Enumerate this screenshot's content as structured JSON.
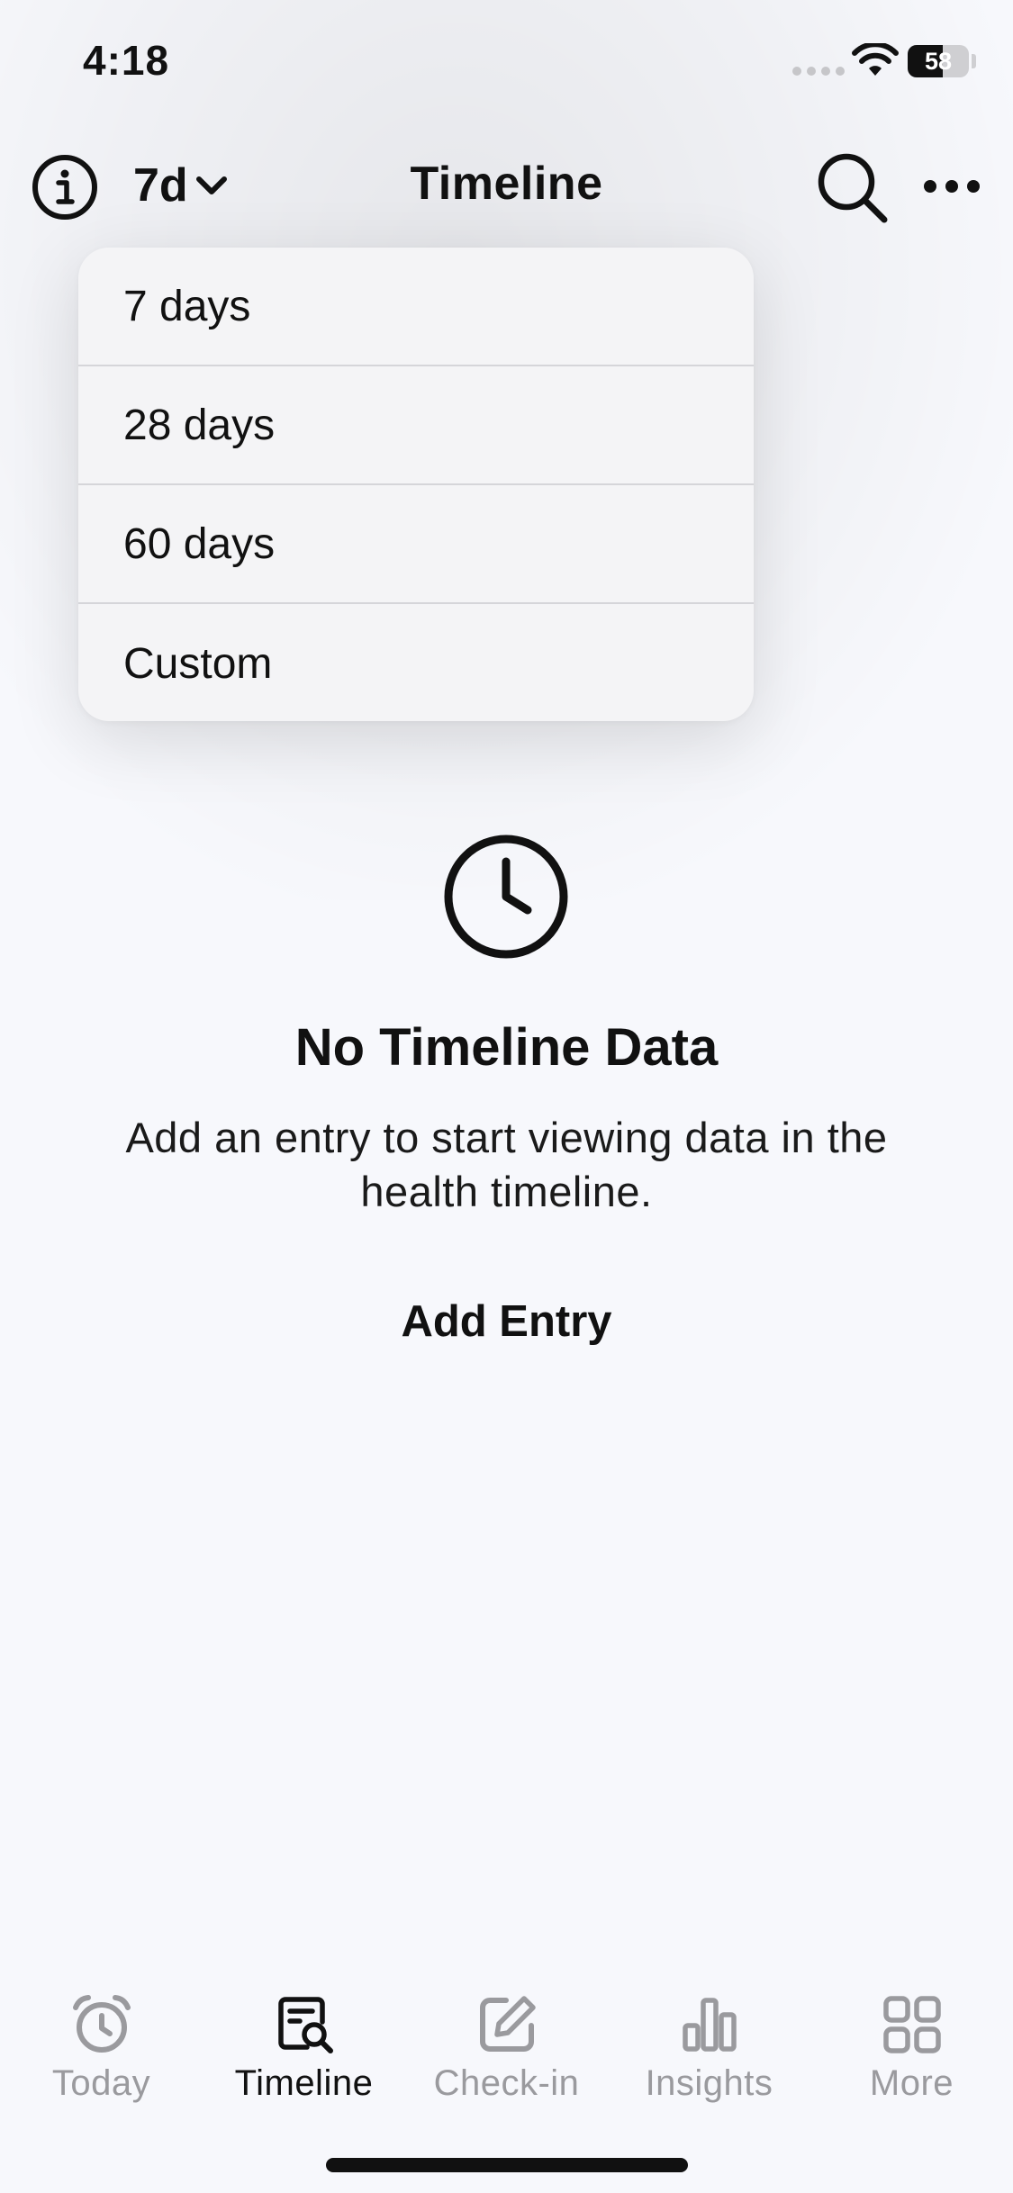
{
  "status_bar": {
    "time": "4:18",
    "battery_percent": 58,
    "battery_label": "58"
  },
  "nav": {
    "range_label": "7d",
    "title": "Timeline"
  },
  "dropdown": {
    "items": [
      "7 days",
      "28 days",
      "60 days",
      "Custom"
    ]
  },
  "empty_state": {
    "title": "No Timeline Data",
    "description": "Add an entry to start viewing data in the health timeline.",
    "action_label": "Add Entry"
  },
  "tab_bar": {
    "tabs": [
      {
        "label": "Today",
        "icon": "alarm-clock-icon",
        "active": false
      },
      {
        "label": "Timeline",
        "icon": "timeline-search-icon",
        "active": true
      },
      {
        "label": "Check-in",
        "icon": "edit-square-icon",
        "active": false
      },
      {
        "label": "Insights",
        "icon": "bar-chart-icon",
        "active": false
      },
      {
        "label": "More",
        "icon": "grid-icon",
        "active": false
      }
    ]
  },
  "colors": {
    "background": "#f7f8fc",
    "text": "#111111",
    "inactive_tab": "#9a9a9e",
    "menu_background": "#f4f4f6"
  }
}
